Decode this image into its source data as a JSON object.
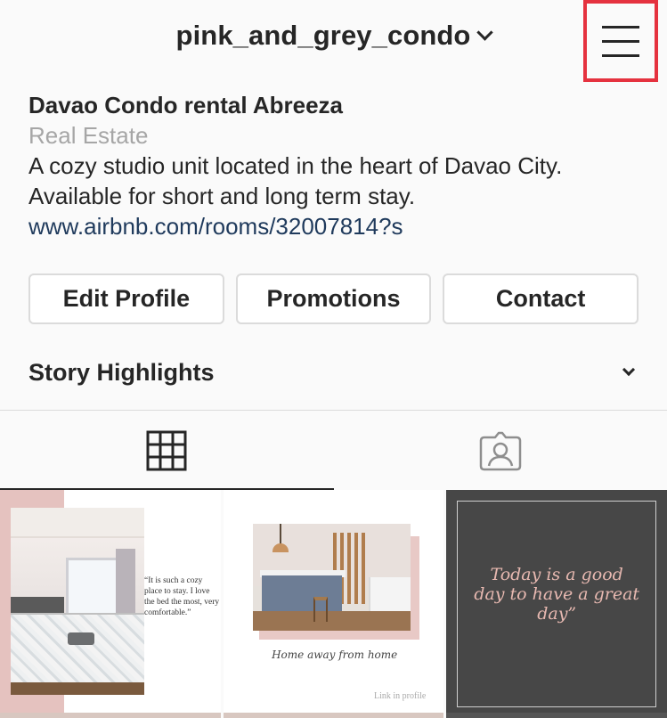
{
  "header": {
    "username": "pink_and_grey_condo",
    "menu_icon": "hamburger-menu-icon",
    "highlight_color": "#e5323f"
  },
  "bio": {
    "name": "Davao Condo rental Abreeza",
    "category": "Real Estate",
    "description_line1": "A cozy studio unit located in the heart of Davao City.",
    "description_line2": "Available for short and long term stay.",
    "link": "www.airbnb.com/rooms/32007814?s"
  },
  "buttons": {
    "edit_profile": "Edit Profile",
    "promotions": "Promotions",
    "contact": "Contact"
  },
  "highlights": {
    "label": "Story Highlights"
  },
  "tabs": [
    {
      "icon": "grid-icon",
      "active": true
    },
    {
      "icon": "tagged-person-icon",
      "active": false
    }
  ],
  "posts": {
    "post1_quote": "“It is such a cozy place to stay. I love the bed the most, very comfortable.”",
    "post2_caption": "Home away from home",
    "post2_small": "Link in profile",
    "post3_quote": "Today is a good day to have a great day”"
  }
}
